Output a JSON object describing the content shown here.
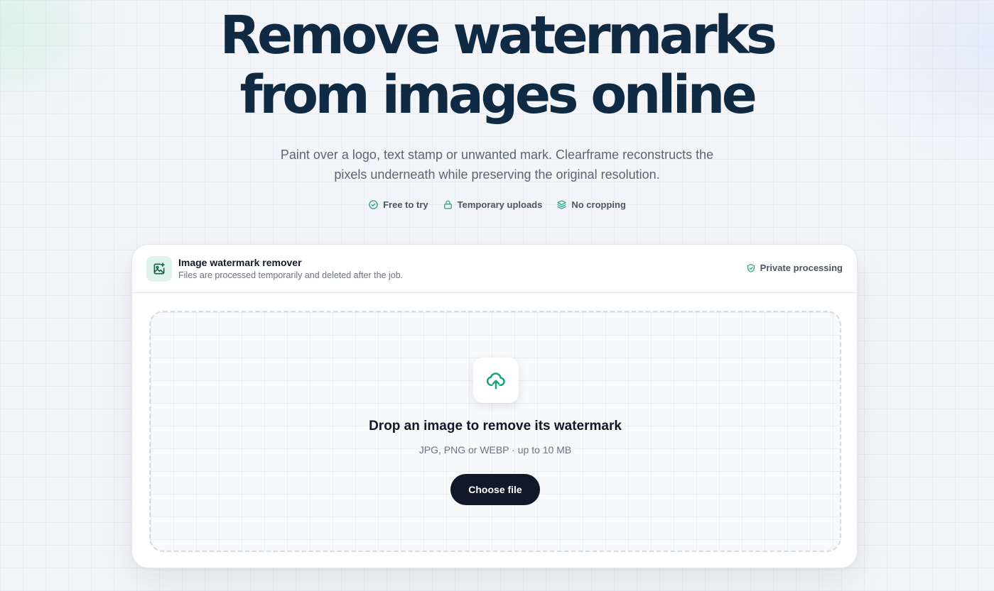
{
  "hero": {
    "title_line1": "Remove watermarks",
    "title_line2": "from images online",
    "subtitle_line1": "Paint over a logo, text stamp or unwanted mark. Clearframe reconstructs the",
    "subtitle_line2": "pixels underneath while preserving the original resolution."
  },
  "features": [
    {
      "icon": "check-circle-icon",
      "label": "Free to try"
    },
    {
      "icon": "lock-icon",
      "label": "Temporary uploads"
    },
    {
      "icon": "layers-icon",
      "label": "No cropping"
    }
  ],
  "card": {
    "icon": "image-plus-icon",
    "title": "Image watermark remover",
    "subtitle": "Files are processed temporarily and deleted after the job.",
    "badge_icon": "shield-check-icon",
    "badge_label": "Private processing"
  },
  "dropzone": {
    "icon": "cloud-upload-icon",
    "title": "Drop an image to remove its watermark",
    "hint": "JPG, PNG or WEBP · up to 10 MB",
    "button_label": "Choose file"
  },
  "colors": {
    "accent": "#16a37f",
    "heading": "#102a43",
    "button": "#111827"
  }
}
